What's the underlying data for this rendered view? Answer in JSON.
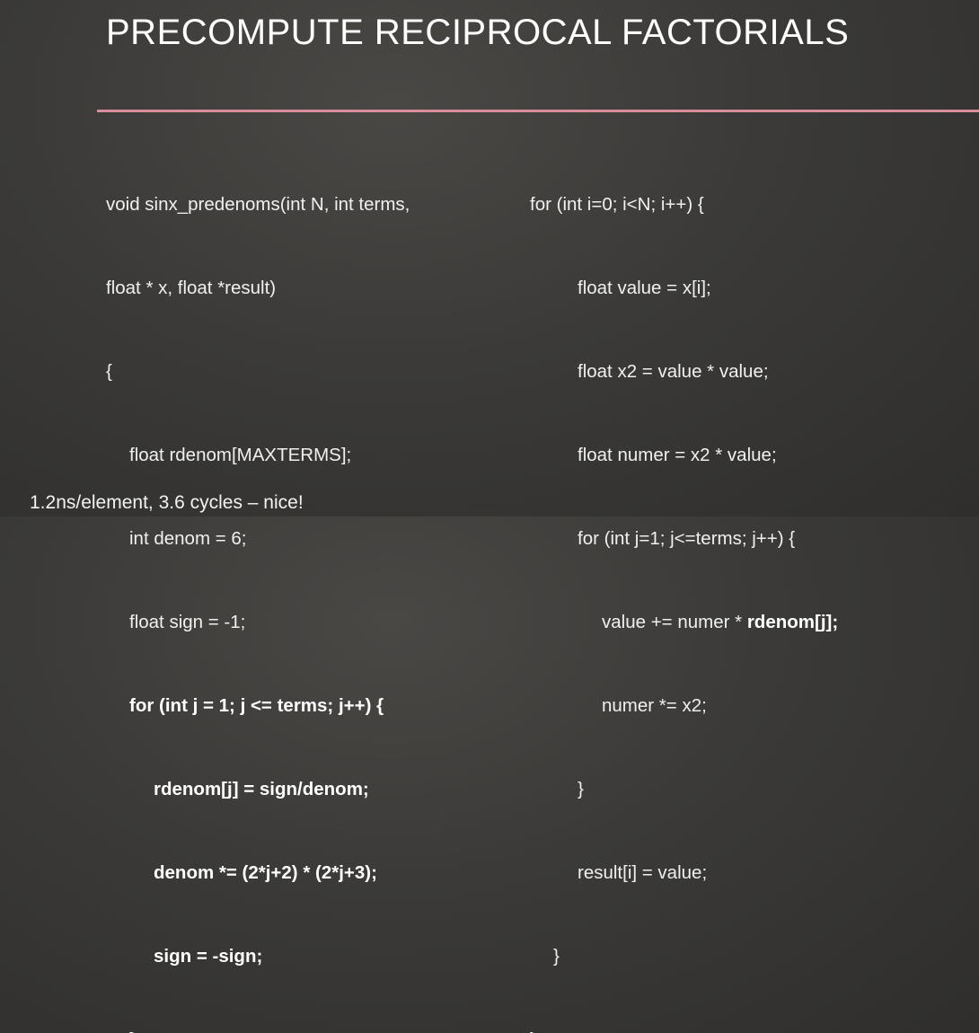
{
  "slide": {
    "title": "PRECOMPUTE RECIPROCAL FACTORIALS",
    "accent_color": "#d98f9a",
    "footer": "1.2ns/element, 3.6 cycles – nice!"
  },
  "code_left": [
    "void sinx_predenoms(int N, int terms,",
    "float * x, float *result)",
    "{",
    "float rdenom[MAXTERMS];",
    "int denom = 6;",
    "float sign = -1;",
    "for (int j = 1; j <= terms; j++) {",
    "rdenom[j] = sign/denom;",
    "denom *= (2*j+2) * (2*j+3);",
    "sign = -sign;",
    "}"
  ],
  "code_right": [
    "for (int i=0; i<N; i++) {",
    "float value = x[i];",
    "float x2 = value * value;",
    "float numer = x2 * value;",
    "for (int j=1; j<=terms; j++) {",
    "value += numer * ",
    "rdenom[j];",
    "numer *= x2;",
    "}",
    "result[i] = value;",
    "}",
    "}"
  ]
}
